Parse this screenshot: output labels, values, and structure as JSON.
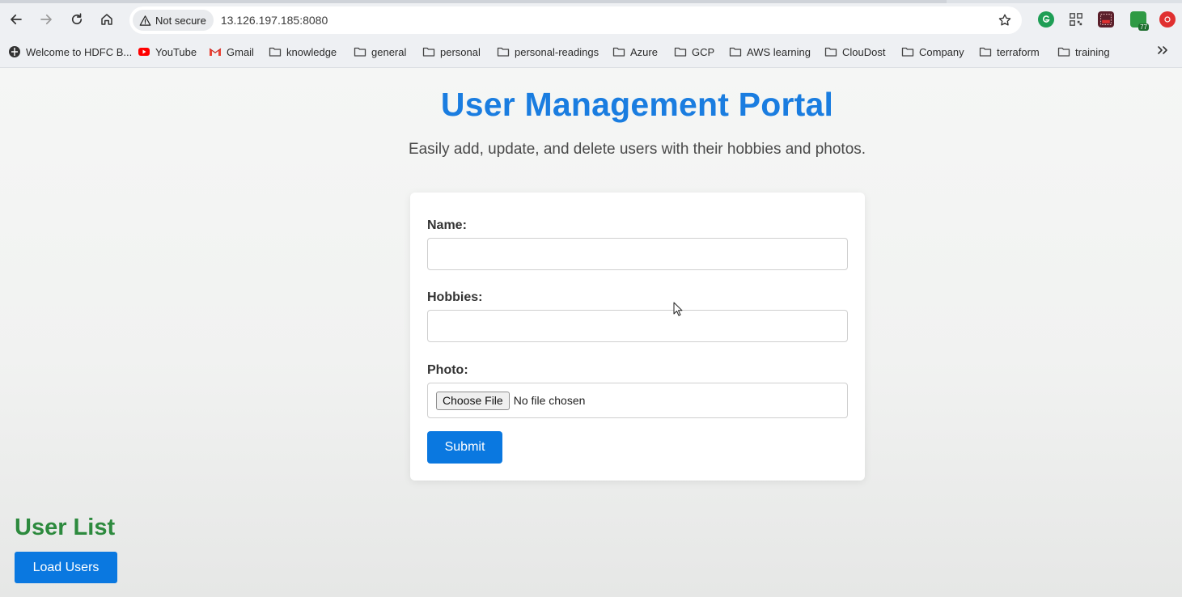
{
  "browser": {
    "security_label": "Not secure",
    "url": "13.126.197.185:8080",
    "bookmarks": [
      {
        "label": "Welcome to HDFC B...",
        "icon": "hdfc-globe-icon"
      },
      {
        "label": "YouTube",
        "icon": "youtube-icon"
      },
      {
        "label": "Gmail",
        "icon": "gmail-icon"
      },
      {
        "label": "knowledge",
        "icon": "folder-icon"
      },
      {
        "label": "general",
        "icon": "folder-icon"
      },
      {
        "label": "personal",
        "icon": "folder-icon"
      },
      {
        "label": "personal-readings",
        "icon": "folder-icon"
      },
      {
        "label": "Azure",
        "icon": "folder-icon"
      },
      {
        "label": "GCP",
        "icon": "folder-icon"
      },
      {
        "label": "AWS learning",
        "icon": "folder-icon"
      },
      {
        "label": "ClouDost",
        "icon": "folder-icon"
      },
      {
        "label": "Company",
        "icon": "folder-icon"
      },
      {
        "label": "terraform",
        "icon": "folder-icon"
      },
      {
        "label": "training",
        "icon": "folder-icon"
      }
    ],
    "extension_badge": "77",
    "colors": {
      "youtube": "#ff0000",
      "extension_green": "#1e9e55",
      "extension_red": "#e03030"
    }
  },
  "page": {
    "title": "User Management Portal",
    "subtitle": "Easily add, update, and delete users with their hobbies and photos.",
    "form": {
      "name_label": "Name:",
      "name_value": "",
      "hobbies_label": "Hobbies:",
      "hobbies_value": "",
      "photo_label": "Photo:",
      "choose_file_label": "Choose File",
      "file_status": "No file chosen",
      "submit_label": "Submit"
    },
    "user_list": {
      "title": "User List",
      "load_label": "Load Users"
    },
    "colors": {
      "title": "#1a7de0",
      "list_title": "#2d8a3e",
      "button": "#0a78e0"
    }
  }
}
